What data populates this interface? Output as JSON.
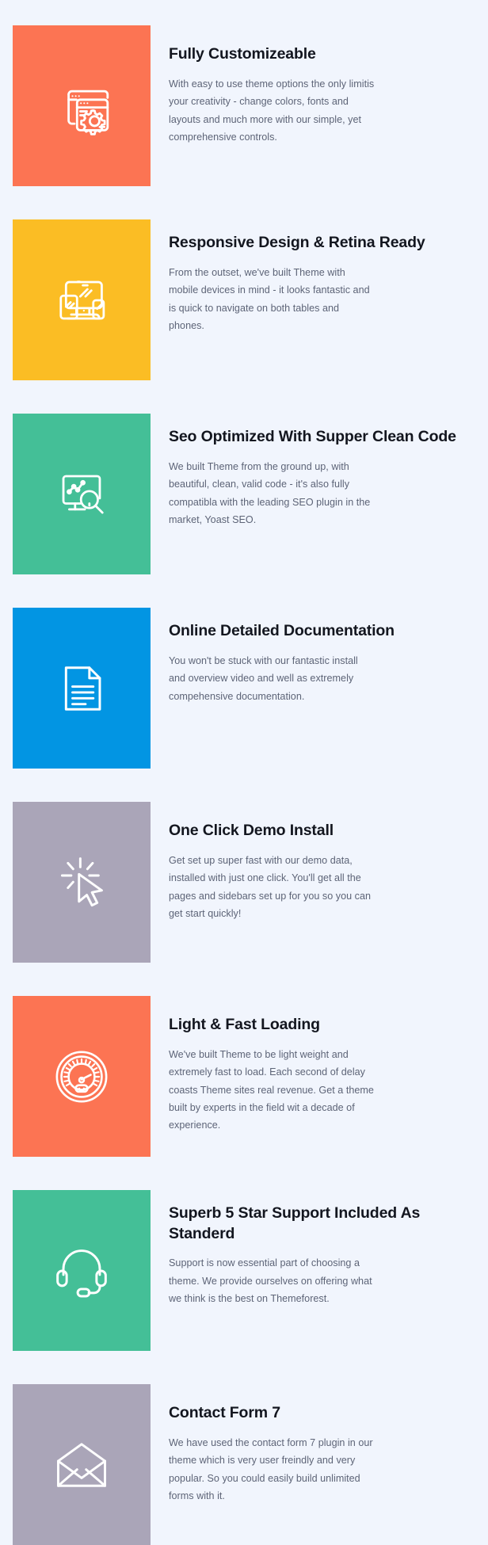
{
  "page": {
    "background_color": "#f1f5fd",
    "title_color": "#13161f",
    "body_color": "#5d6477",
    "icon_color": "#ffffff"
  },
  "features": [
    {
      "title": "Fully Customizeable",
      "body": "With easy to use theme options the only limitis your creativity - change colors, fonts and layouts and much more with our simple, yet comprehensive controls.",
      "tile_color": "#fc7453",
      "icon": "browser-windows-gear-icon"
    },
    {
      "title": "Responsive Design & Retina Ready",
      "body": "From the outset, we've built Theme with mobile devices in mind - it looks fantastic and is quick to navigate on both tables and phones.",
      "tile_color": "#fbbd24",
      "icon": "responsive-devices-icon"
    },
    {
      "title": "Seo Optimized With Supper Clean Code",
      "body": "We built Theme from the ground up, with beautiful, clean, valid code - it's also fully compatibla with the leading SEO plugin in the market, Yoast SEO.",
      "tile_color": "#44bf97",
      "icon": "seo-analytics-magnifier-icon"
    },
    {
      "title": "Online Detailed Documentation",
      "body": "You won't be stuck with our fantastic install and overview video and well as extremely compehensive documentation.",
      "tile_color": "#0295e3",
      "icon": "document-page-icon"
    },
    {
      "title": "One Click Demo Install",
      "body": "Get set up super fast with our demo data, installed with just one click. You'll get all the pages and sidebars set up for you so you can get start quickly!",
      "tile_color": "#aaa5b8",
      "icon": "click-cursor-icon"
    },
    {
      "title": "Light & Fast Loading",
      "body": "We've built Theme to be light weight and extremely fast to load. Each second of delay coasts Theme sites real revenue. Get a theme built by experts in the field wit a decade of experience.",
      "tile_color": "#fc7453",
      "icon": "speedometer-icon"
    },
    {
      "title": "Superb 5 Star Support Included As Standerd",
      "body": "Support is now essential part of choosing a theme. We provide ourselves on offering what we think is the best on Themeforest.",
      "tile_color": "#44bf97",
      "icon": "headset-support-icon"
    },
    {
      "title": "Contact Form 7",
      "body": "We have used the contact form 7 plugin in our theme which is very user freindly and very popular. So you could easily build unlimited forms with it.",
      "tile_color": "#aaa5b8",
      "icon": "envelope-mail-icon"
    }
  ]
}
